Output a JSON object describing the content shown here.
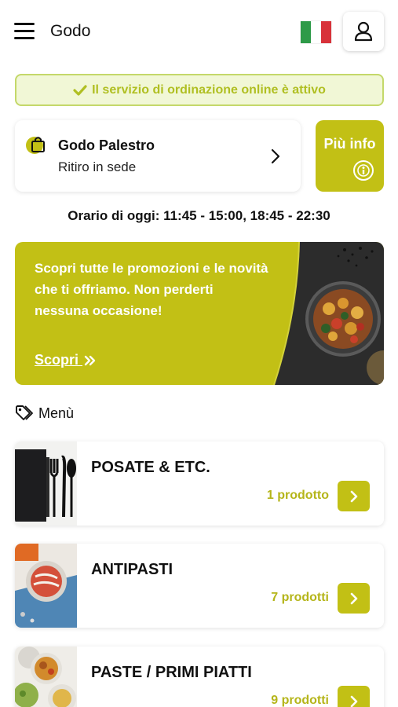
{
  "header": {
    "title": "Godo",
    "menu_icon": "hamburger-menu-icon",
    "language_flag": "italian-flag-icon",
    "profile_icon": "user-icon"
  },
  "status": {
    "text": "Il servizio di ordinazione online è attivo",
    "icon": "check-icon"
  },
  "store": {
    "name": "Godo Palestro",
    "mode": "Ritiro in sede",
    "icon": "shopping-bag-icon"
  },
  "info_button": {
    "label": "Più info",
    "icon": "info-icon"
  },
  "hours": "Orario di oggi: 11:45 - 15:00, 18:45 - 22:30",
  "promo": {
    "text": "Scopri tutte le promozioni e le novità che ti offriamo. Non perderti nessuna occasione!",
    "link_label": "Scopri"
  },
  "menu_section": {
    "label": "Menù",
    "icon": "tag-icon"
  },
  "categories": [
    {
      "name": "POSATE & ETC.",
      "count": "1 prodotto"
    },
    {
      "name": "ANTIPASTI",
      "count": "7 prodotti"
    },
    {
      "name": "PASTE / PRIMI PIATTI",
      "count": "9 prodotti"
    }
  ],
  "colors": {
    "accent": "#c2c015",
    "accent_text": "#b5b51a",
    "status_bg": "#f1f7d6",
    "status_border": "#c4d86a"
  }
}
